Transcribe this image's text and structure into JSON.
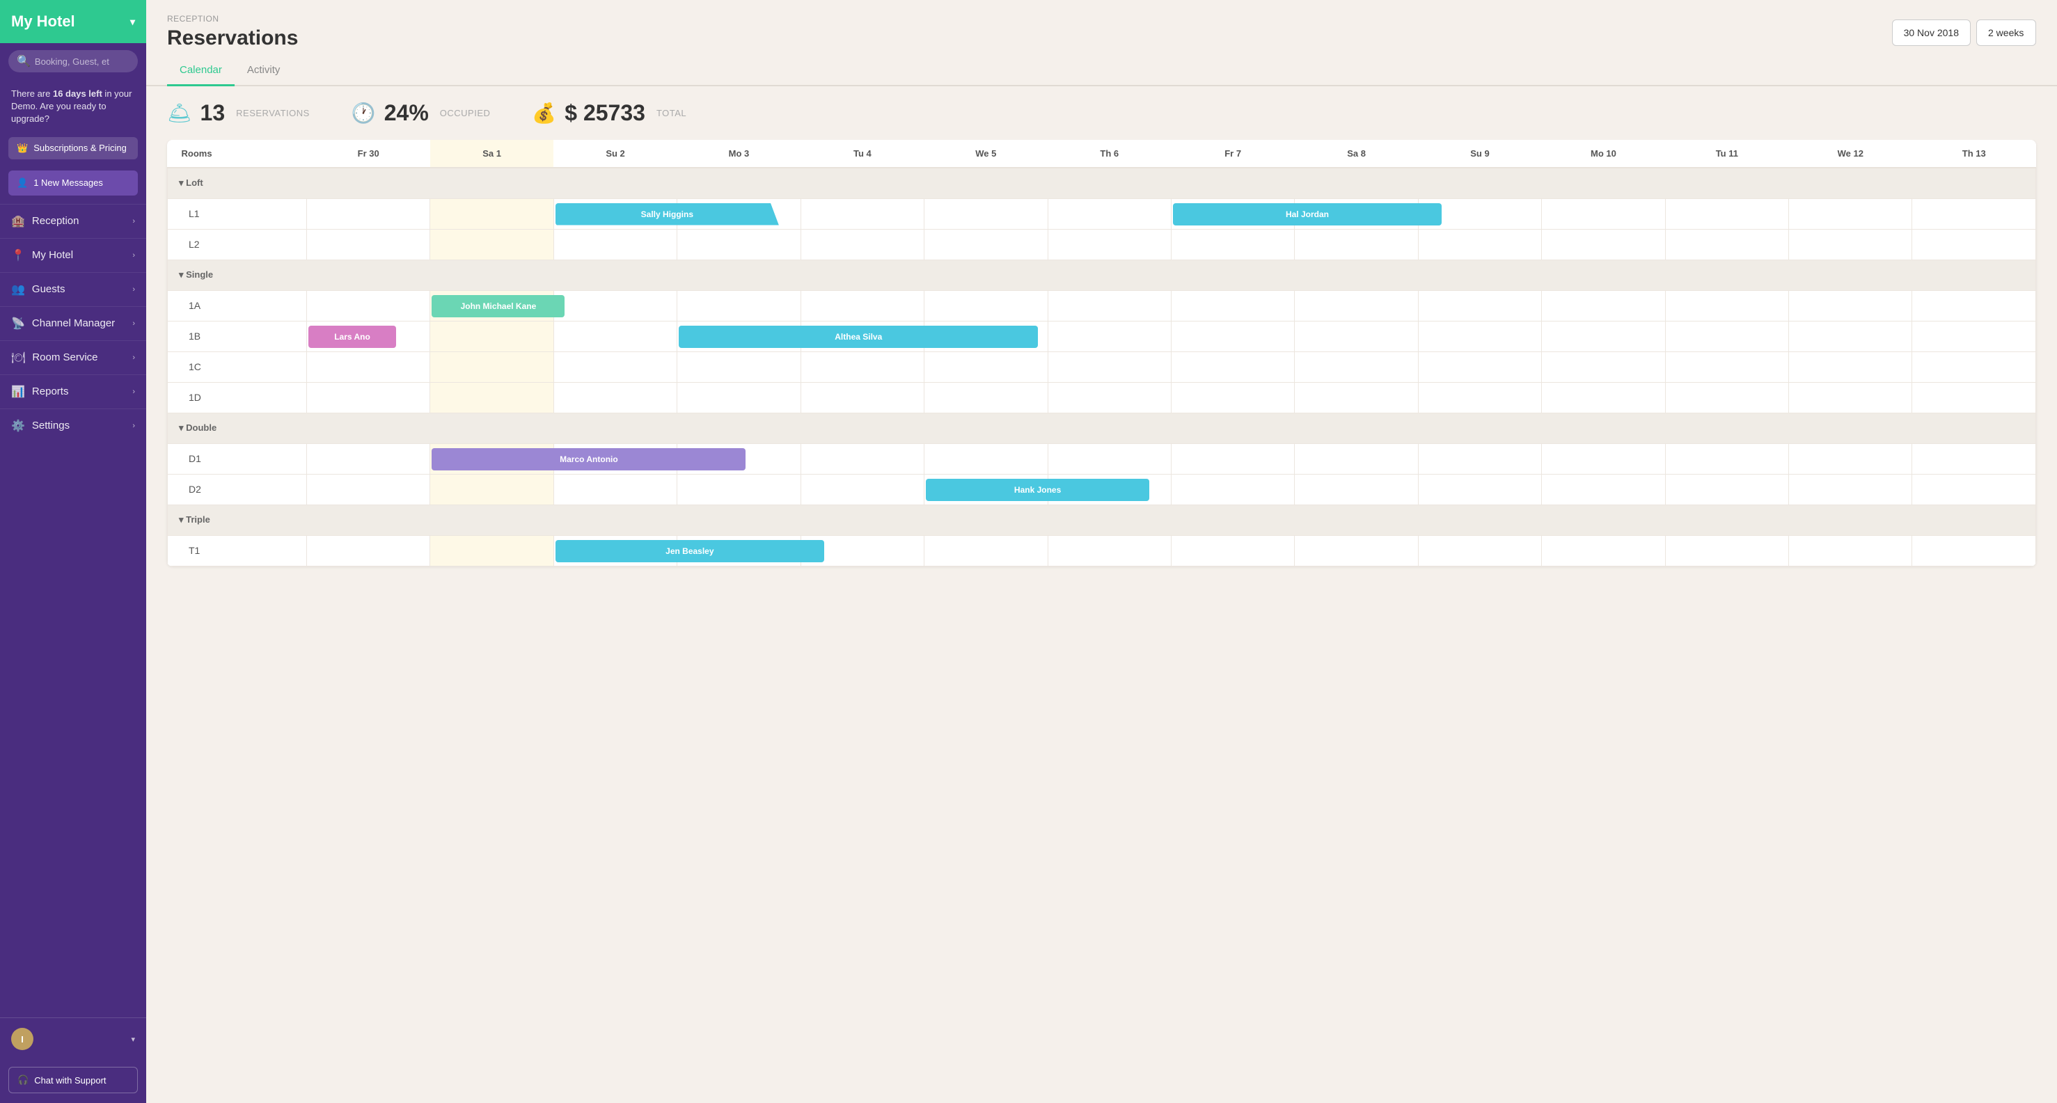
{
  "sidebar": {
    "hotel_name": "My Hotel",
    "search_placeholder": "Booking, Guest, et",
    "demo_notice": "There are ",
    "demo_days": "16 days left",
    "demo_notice2": " in your Demo. Are you ready to upgrade?",
    "subscriptions_label": "Subscriptions & Pricing",
    "messages_label": "1 New Messages",
    "nav_items": [
      {
        "id": "reception",
        "label": "Reception",
        "icon": "🏨"
      },
      {
        "id": "my-hotel",
        "label": "My Hotel",
        "icon": "📍"
      },
      {
        "id": "guests",
        "label": "Guests",
        "icon": "👥"
      },
      {
        "id": "channel-manager",
        "label": "Channel Manager",
        "icon": "📡"
      },
      {
        "id": "room-service",
        "label": "Room Service",
        "icon": "🍽"
      },
      {
        "id": "reports",
        "label": "Reports",
        "icon": "📊"
      },
      {
        "id": "settings",
        "label": "Settings",
        "icon": "⚙️"
      }
    ],
    "user_initial": "I",
    "chat_support_label": "Chat with Support"
  },
  "header": {
    "breadcrumb": "RECEPTION",
    "title": "Reservations",
    "date": "30 Nov 2018",
    "duration": "2 weeks"
  },
  "tabs": [
    {
      "id": "calendar",
      "label": "Calendar",
      "active": true
    },
    {
      "id": "activity",
      "label": "Activity",
      "active": false
    }
  ],
  "stats": [
    {
      "id": "reservations",
      "value": "13",
      "label": "RESERVATIONS",
      "icon": "🛎"
    },
    {
      "id": "occupied",
      "value": "24",
      "label": "OCCUPIED",
      "suffix": "%",
      "icon": "🕐"
    },
    {
      "id": "total",
      "value": "$ 25733",
      "label": "TOTAL",
      "icon": "💰"
    }
  ],
  "calendar": {
    "rooms_header": "Rooms",
    "columns": [
      {
        "label": "Fr 30",
        "today": false
      },
      {
        "label": "Sa 1",
        "today": true
      },
      {
        "label": "Su 2",
        "today": false
      },
      {
        "label": "Mo 3",
        "today": false
      },
      {
        "label": "Tu 4",
        "today": false
      },
      {
        "label": "We 5",
        "today": false
      },
      {
        "label": "Th 6",
        "today": false
      },
      {
        "label": "Fr 7",
        "today": false
      },
      {
        "label": "Sa 8",
        "today": false
      },
      {
        "label": "Su 9",
        "today": false
      },
      {
        "label": "Mo 10",
        "today": false
      },
      {
        "label": "Tu 11",
        "today": false
      },
      {
        "label": "We 12",
        "today": false
      },
      {
        "label": "Th 13",
        "today": false
      }
    ],
    "categories": [
      {
        "name": "Loft",
        "rooms": [
          {
            "id": "L1",
            "reservations": [
              {
                "guest": "Sally Higgins",
                "start": 3,
                "span": 5,
                "color": "cyan"
              },
              {
                "guest": "Hal Jordan",
                "start": 8,
                "span": 6,
                "color": "cyan"
              }
            ]
          },
          {
            "id": "L2",
            "reservations": []
          }
        ]
      },
      {
        "name": "Single",
        "rooms": [
          {
            "id": "1A",
            "reservations": [
              {
                "guest": "John Michael Kane",
                "start": 2,
                "span": 3,
                "color": "green"
              }
            ]
          },
          {
            "id": "1B",
            "reservations": [
              {
                "guest": "Lars Ano",
                "start": 1,
                "span": 2,
                "color": "pink"
              },
              {
                "guest": "Althea Silva",
                "start": 4,
                "span": 8,
                "color": "cyan"
              }
            ]
          },
          {
            "id": "1C",
            "reservations": []
          },
          {
            "id": "1D",
            "reservations": []
          }
        ]
      },
      {
        "name": "Double",
        "rooms": [
          {
            "id": "D1",
            "reservations": [
              {
                "guest": "Marco Antonio",
                "start": 2,
                "span": 7,
                "color": "purple"
              }
            ]
          },
          {
            "id": "D2",
            "reservations": [
              {
                "guest": "Hank Jones",
                "start": 6,
                "span": 5,
                "color": "cyan"
              }
            ]
          }
        ]
      },
      {
        "name": "Triple",
        "rooms": [
          {
            "id": "T1",
            "reservations": [
              {
                "guest": "Jen Beasley",
                "start": 3,
                "span": 6,
                "color": "cyan"
              }
            ]
          }
        ]
      }
    ]
  }
}
